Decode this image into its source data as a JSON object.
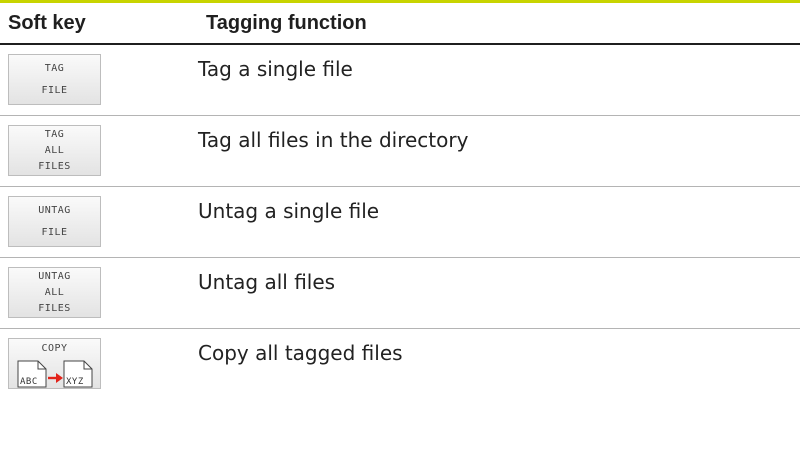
{
  "header": {
    "col1": "Soft key",
    "col2": "Tagging function"
  },
  "rows": [
    {
      "key_lines": [
        "TAG",
        "FILE"
      ],
      "description": "Tag a single file"
    },
    {
      "key_lines": [
        "TAG",
        "ALL",
        "FILES"
      ],
      "description": "Tag all files in the directory"
    },
    {
      "key_lines": [
        "UNTAG",
        "FILE"
      ],
      "description": "Untag a single file"
    },
    {
      "key_lines": [
        "UNTAG",
        "ALL",
        "FILES"
      ],
      "description": "Untag all files"
    },
    {
      "key_lines": [
        "COPY"
      ],
      "icon": {
        "from": "ABC",
        "to": "XYZ",
        "arrow_color": "#e2231a"
      },
      "description": "Copy all tagged files"
    }
  ],
  "colors": {
    "accent_rule": "#c8d400",
    "header_rule": "#1f1f1f",
    "row_divider": "#b4b4b4"
  }
}
